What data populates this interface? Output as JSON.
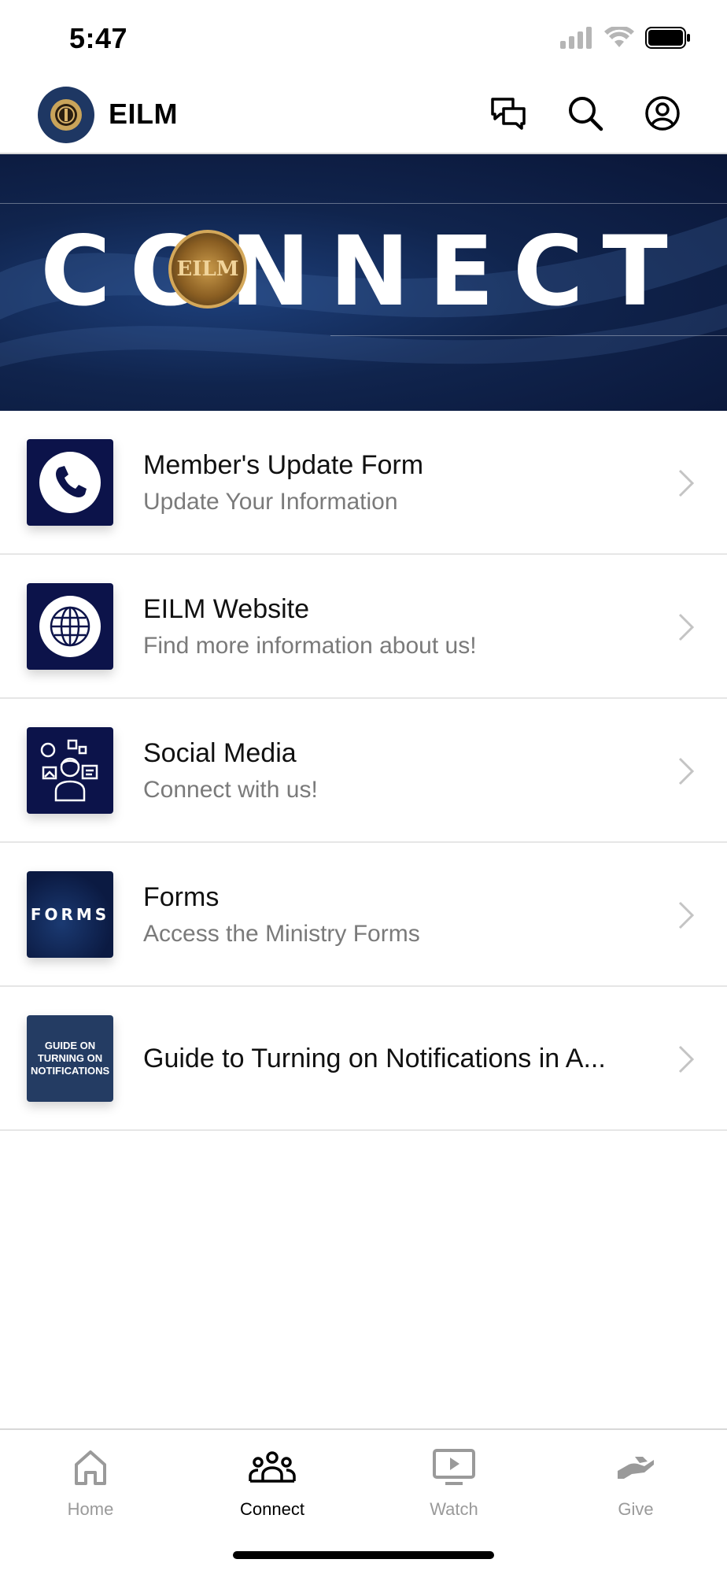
{
  "status_bar": {
    "time": "5:47"
  },
  "header": {
    "title": "EILM"
  },
  "banner": {
    "title": "CONNECT",
    "seal_letters": "EILM"
  },
  "list": {
    "items": [
      {
        "title": "Member's Update Form",
        "subtitle": "Update Your Information",
        "icon": "phone-icon"
      },
      {
        "title": "EILM Website",
        "subtitle": "Find more information about us!",
        "icon": "globe-icon"
      },
      {
        "title": "Social Media",
        "subtitle": "Connect with us!",
        "icon": "social-media-icon"
      },
      {
        "title": "Forms",
        "subtitle": "Access the Ministry Forms",
        "thumb_text": "FORMS"
      },
      {
        "title": "Guide to Turning on Notifications in A...",
        "thumb_text": "GUIDE ON TURNING ON NOTIFICATIONS"
      }
    ]
  },
  "tabs": [
    {
      "label": "Home",
      "icon": "home-icon",
      "active": false
    },
    {
      "label": "Connect",
      "icon": "people-icon",
      "active": true
    },
    {
      "label": "Watch",
      "icon": "play-screen-icon",
      "active": false
    },
    {
      "label": "Give",
      "icon": "give-hand-icon",
      "active": false
    }
  ],
  "colors": {
    "brand_navy": "#0c134a",
    "banner_blue": "#10244d",
    "inactive_tab": "#9a9a9a"
  }
}
